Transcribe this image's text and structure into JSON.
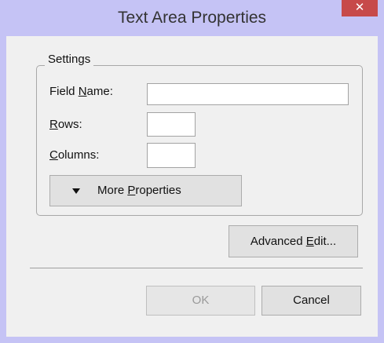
{
  "window": {
    "title": "Text Area Properties",
    "close_glyph": "✕"
  },
  "settings": {
    "legend": "Settings",
    "field_name": {
      "pre": "Field ",
      "key": "N",
      "post": "ame:",
      "value": ""
    },
    "rows": {
      "pre": "",
      "key": "R",
      "post": "ows:",
      "value": ""
    },
    "columns": {
      "pre": "",
      "key": "C",
      "post": "olumns:",
      "value": ""
    },
    "more_properties": {
      "icon": "triangle-down-icon",
      "pre": "More ",
      "key": "P",
      "post": "roperties"
    }
  },
  "advanced_edit": {
    "pre": "Advanced ",
    "key": "E",
    "post": "dit..."
  },
  "ok_label": "OK",
  "cancel_label": "Cancel",
  "colors": {
    "title_bar": "#c5c3f5",
    "close_button": "#c74a4a",
    "dialog_bg": "#f0f0f0"
  }
}
